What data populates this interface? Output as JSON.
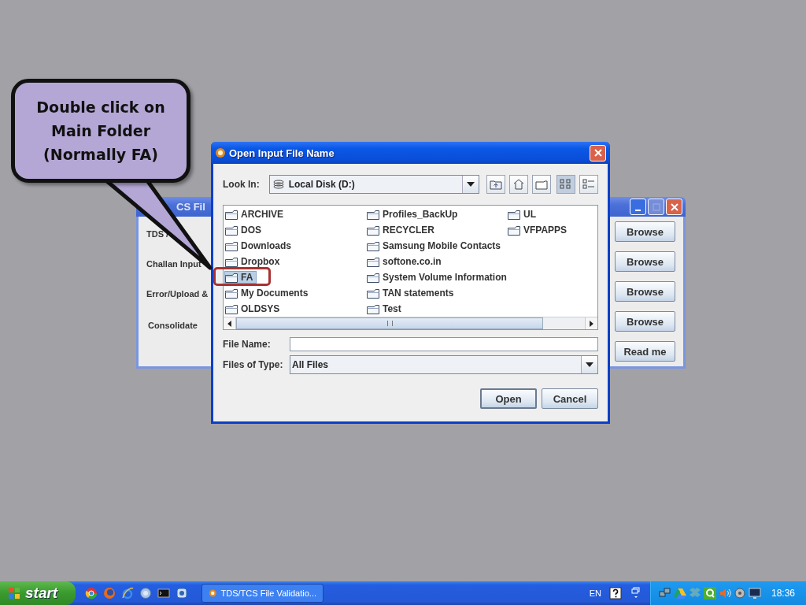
{
  "back_window": {
    "title": "CS Fil",
    "labels": [
      "TDS /",
      "Challan Input",
      "Error/Upload &",
      "Consolidate"
    ],
    "buttons": [
      "Browse",
      "Browse",
      "Browse",
      "Browse",
      "Read me"
    ]
  },
  "dialog": {
    "title": "Open Input File Name",
    "look_in": {
      "label": "Look In:",
      "value": "Local Disk (D:)"
    },
    "view_buttons": [
      {
        "kind": "up",
        "selected": false
      },
      {
        "kind": "home",
        "selected": false
      },
      {
        "kind": "new-folder",
        "selected": false
      },
      {
        "kind": "list",
        "selected": true
      },
      {
        "kind": "details",
        "selected": false
      }
    ],
    "files": [
      {
        "name": "ARCHIVE",
        "selected": false
      },
      {
        "name": "DOS",
        "selected": false
      },
      {
        "name": "Downloads",
        "selected": false
      },
      {
        "name": "Dropbox",
        "selected": false
      },
      {
        "name": "FA",
        "selected": true
      },
      {
        "name": "My Documents",
        "selected": false
      },
      {
        "name": "OLDSYS",
        "selected": false
      },
      {
        "name": "Profiles_BackUp",
        "selected": false
      },
      {
        "name": "RECYCLER",
        "selected": false
      },
      {
        "name": "Samsung Mobile Contacts",
        "selected": false
      },
      {
        "name": "softone.co.in",
        "selected": false
      },
      {
        "name": "System Volume Information",
        "selected": false
      },
      {
        "name": "TAN statements",
        "selected": false
      },
      {
        "name": "Test",
        "selected": false
      },
      {
        "name": "UL",
        "selected": false
      },
      {
        "name": "VFPAPPS",
        "selected": false
      }
    ],
    "file_name": {
      "label": "File Name:"
    },
    "files_of_type": {
      "label": "Files of Type:",
      "value": "All Files"
    },
    "buttons": [
      "Open",
      "Cancel"
    ]
  },
  "callout": {
    "text": "Double click on Main Folder (Normally FA)"
  },
  "taskbar": {
    "start": "start",
    "task": {
      "title": "TDS/TCS File Validatio...",
      "selected": false
    },
    "language": "EN",
    "clock": "18:36"
  }
}
